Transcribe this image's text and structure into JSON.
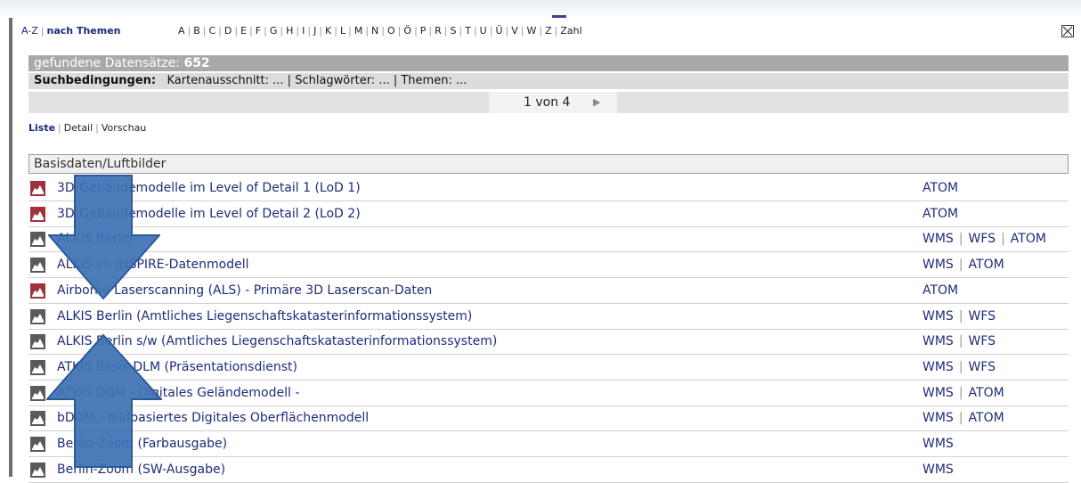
{
  "nav": {
    "az_label": "A-Z",
    "themes_label": "nach Themen",
    "letters": [
      "A",
      "B",
      "C",
      "D",
      "E",
      "F",
      "G",
      "H",
      "I",
      "J",
      "K",
      "L",
      "M",
      "N",
      "O",
      "Ö",
      "P",
      "R",
      "S",
      "T",
      "U",
      "Ü",
      "V",
      "W",
      "Z",
      "Zahl"
    ]
  },
  "results": {
    "found_label": "gefundene Datensätze:",
    "found_count": "652",
    "conditions_label": "Suchbedingungen:",
    "conditions_text": "Kartenausschnitt: ... | Schlagwörter: ... | Themen: ...",
    "page_text": "1 von 4"
  },
  "views": {
    "list": "Liste",
    "detail": "Detail",
    "preview": "Vorschau"
  },
  "category": "Basisdaten/Luftbilder",
  "rows": [
    {
      "title": "3D-Gebäudemodelle im Level of Detail 1 (LoD 1)",
      "icon": "red",
      "services": [
        "ATOM"
      ]
    },
    {
      "title": "3D-Gebäudemodelle im Level of Detail 2 (LoD 2)",
      "icon": "red",
      "services": [
        "ATOM"
      ]
    },
    {
      "title": "ALKIS Berlin",
      "icon": "gray",
      "services": [
        "WMS",
        "WFS",
        "ATOM"
      ]
    },
    {
      "title": "ALKIS im INSPIRE-Datenmodell",
      "icon": "gray",
      "services": [
        "WMS",
        "ATOM"
      ]
    },
    {
      "title": "Airborne Laserscanning (ALS) - Primäre 3D Laserscan-Daten",
      "icon": "red",
      "services": [
        "ATOM"
      ]
    },
    {
      "title": "ALKIS Berlin (Amtliches Liegenschaftskatasterinformationssystem)",
      "icon": "gray",
      "services": [
        "WMS",
        "WFS"
      ]
    },
    {
      "title": "ALKIS Berlin s/w (Amtliches Liegenschaftskatasterinformationssystem)",
      "icon": "gray",
      "services": [
        "WMS",
        "WFS"
      ]
    },
    {
      "title": "ATKIS Basis-DLM (Präsentationsdienst)",
      "icon": "gray",
      "services": [
        "WMS",
        "WFS"
      ]
    },
    {
      "title": "ATKIS DGM - Digitales Geländemodell -",
      "icon": "gray",
      "services": [
        "WMS",
        "ATOM"
      ]
    },
    {
      "title": "bDOM - bildbasiertes Digitales Oberflächenmodell",
      "icon": "gray",
      "services": [
        "WMS",
        "ATOM"
      ]
    },
    {
      "title": "Berlin-Zoom (Farbausgabe)",
      "icon": "gray",
      "services": [
        "WMS"
      ]
    },
    {
      "title": "Berlin-Zoom (SW-Ausgabe)",
      "icon": "gray",
      "services": [
        "WMS"
      ]
    }
  ],
  "colors": {
    "icon_red": "#a0323c",
    "icon_gray": "#5a5a5a",
    "link": "#1e2c7a",
    "arrow": "#3f72b5"
  }
}
